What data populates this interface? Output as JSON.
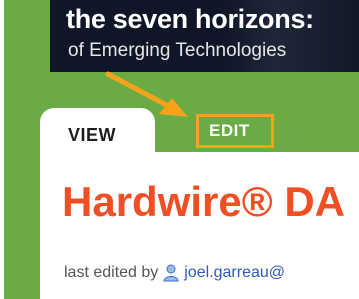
{
  "banner": {
    "title": "the seven horizons:",
    "subtitle": "of Emerging Technologies"
  },
  "tabs": {
    "view_label": "VIEW",
    "edit_label": "EDIT"
  },
  "page": {
    "title": "Hardwire® DA"
  },
  "meta": {
    "prefix": "last edited by",
    "user": "joel.garreau@"
  },
  "colors": {
    "frame": "#6aab45",
    "highlight": "#f7a21b",
    "title": "#f04e23",
    "link": "#2d5bb8"
  },
  "icons": {
    "user": "user-icon",
    "annotation_arrow": "arrow-icon"
  }
}
